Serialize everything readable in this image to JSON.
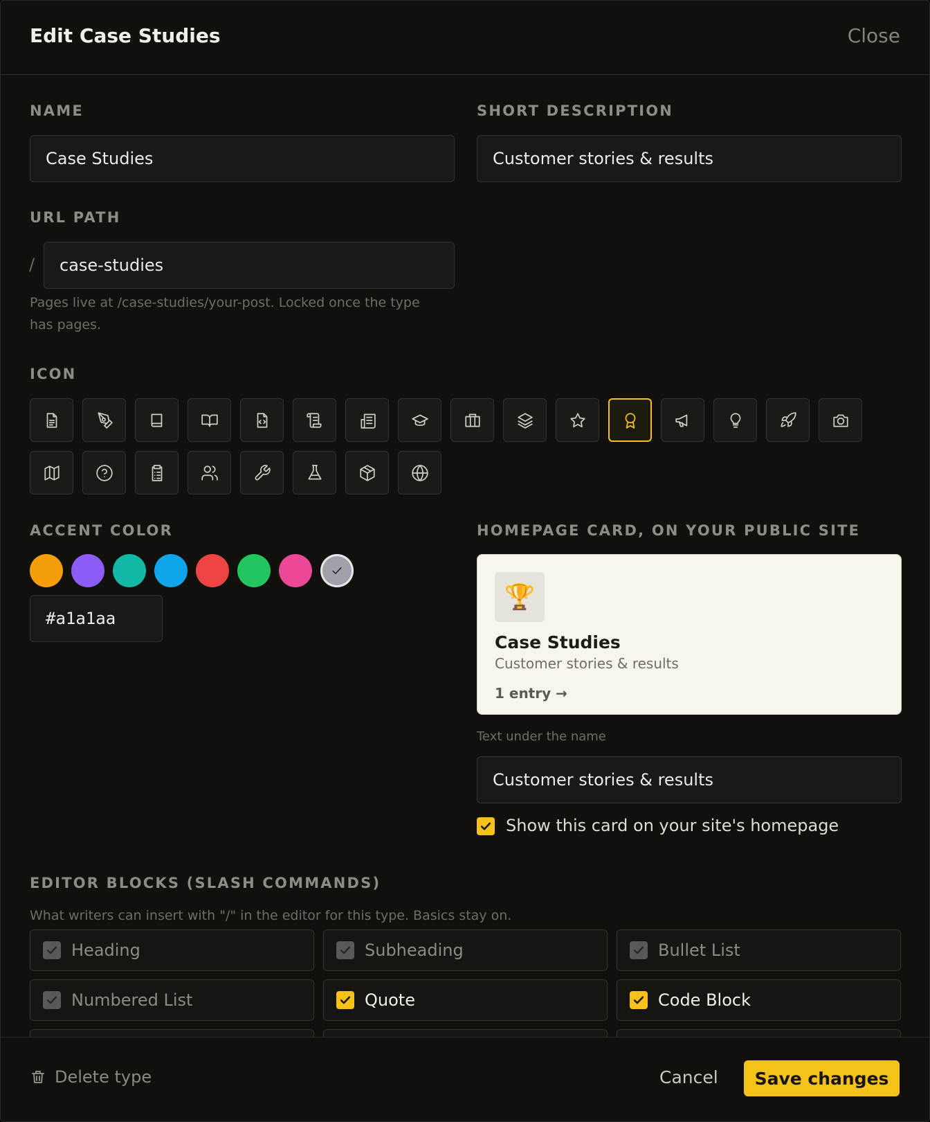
{
  "header": {
    "title": "Edit Case Studies",
    "close_label": "Close"
  },
  "form": {
    "name_label": "NAME",
    "name_value": "Case Studies",
    "short_desc_label": "SHORT DESCRIPTION",
    "short_desc_value": "Customer stories & results",
    "url_label": "URL PATH",
    "url_prefix": "/",
    "url_value": "case-studies",
    "url_hint": "Pages live at /case-studies/your-post. Locked once the type has pages.",
    "icon_label": "ICON",
    "icons": [
      {
        "name": "file-text-icon",
        "selected": false
      },
      {
        "name": "pen-tool-icon",
        "selected": false
      },
      {
        "name": "book-icon",
        "selected": false
      },
      {
        "name": "book-open-icon",
        "selected": false
      },
      {
        "name": "file-code-icon",
        "selected": false
      },
      {
        "name": "scroll-icon",
        "selected": false
      },
      {
        "name": "newspaper-icon",
        "selected": false
      },
      {
        "name": "graduation-cap-icon",
        "selected": false
      },
      {
        "name": "briefcase-icon",
        "selected": false
      },
      {
        "name": "layers-icon",
        "selected": false
      },
      {
        "name": "star-icon",
        "selected": false
      },
      {
        "name": "award-icon",
        "selected": true
      },
      {
        "name": "megaphone-icon",
        "selected": false
      },
      {
        "name": "lightbulb-icon",
        "selected": false
      },
      {
        "name": "rocket-icon",
        "selected": false
      },
      {
        "name": "camera-icon",
        "selected": false
      },
      {
        "name": "map-icon",
        "selected": false
      },
      {
        "name": "help-circle-icon",
        "selected": false
      },
      {
        "name": "clipboard-list-icon",
        "selected": false
      },
      {
        "name": "users-icon",
        "selected": false
      },
      {
        "name": "wrench-icon",
        "selected": false
      },
      {
        "name": "flask-icon",
        "selected": false
      },
      {
        "name": "package-icon",
        "selected": false
      },
      {
        "name": "globe-icon",
        "selected": false
      }
    ],
    "accent_label": "ACCENT COLOR",
    "accent_colors": [
      "#f59e0b",
      "#8b5cf6",
      "#14b8a6",
      "#0ea5e9",
      "#ef4444",
      "#22c55e",
      "#ec4899",
      "#a1a1aa"
    ],
    "accent_selected": "#a1a1aa",
    "accent_value": "#a1a1aa"
  },
  "card_preview": {
    "label": "HOMEPAGE CARD, ON YOUR PUBLIC SITE",
    "icon": "trophy-icon",
    "title": "Case Studies",
    "description": "Customer stories & results",
    "count": "1 entry →",
    "text_under_label": "Text under the name",
    "text_under_value": "Customer stories & results",
    "show_on_homepage_label": "Show this card on your site's homepage",
    "show_on_homepage": true
  },
  "editor_blocks": {
    "label": "EDITOR BLOCKS (SLASH COMMANDS)",
    "hint": "What writers can insert with \"/\" in the editor for this type. Basics stay on.",
    "blocks": [
      {
        "label": "Heading",
        "checked": true,
        "locked": true
      },
      {
        "label": "Subheading",
        "checked": true,
        "locked": true
      },
      {
        "label": "Bullet List",
        "checked": true,
        "locked": true
      },
      {
        "label": "Numbered List",
        "checked": true,
        "locked": true
      },
      {
        "label": "Quote",
        "checked": true,
        "locked": false
      },
      {
        "label": "Code Block",
        "checked": true,
        "locked": false
      }
    ]
  },
  "footer": {
    "delete_label": "Delete type",
    "cancel_label": "Cancel",
    "save_label": "Save changes"
  },
  "colors": {
    "accent": "#f5c21a",
    "background": "#11100d",
    "card_background": "#f8f5ec"
  }
}
